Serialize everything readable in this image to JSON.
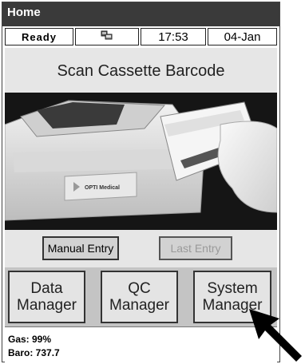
{
  "titlebar": {
    "title": "Home"
  },
  "status": {
    "state": "Ready",
    "network_icon": "network-icon",
    "time": "17:53",
    "date": "04-Jan"
  },
  "main": {
    "prompt": "Scan Cassette Barcode",
    "photo_brand": "OPTI Medical"
  },
  "buttons": {
    "manual_entry": "Manual Entry",
    "last_entry": "Last Entry"
  },
  "managers": [
    {
      "line1": "Data",
      "line2": "Manager"
    },
    {
      "line1": "QC",
      "line2": "Manager"
    },
    {
      "line1": "System",
      "line2": "Manager"
    }
  ],
  "footer": {
    "gas": "Gas: 99%",
    "baro": "Baro: 737.7"
  },
  "colors": {
    "titlebar": "#3a3a3a",
    "content_bg": "#e6e6e6",
    "bottom_bg": "#c4c4c4"
  }
}
